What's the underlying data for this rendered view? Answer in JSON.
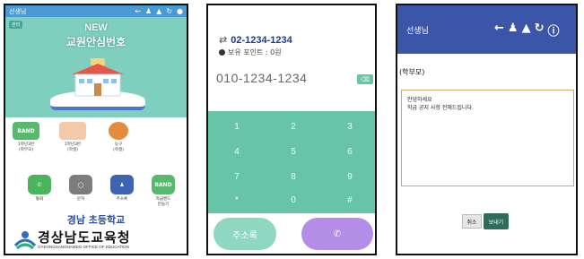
{
  "screen1": {
    "status_title": "선생님",
    "status_icons": [
      "back-arrow-icon",
      "person-icon",
      "bell-icon",
      "refresh-icon",
      "info-icon"
    ],
    "badge": "관리",
    "hero_new": "NEW",
    "hero_title": "교원안심번호",
    "shortcuts": [
      {
        "name": "band",
        "icon_text": "BAND",
        "label": "1학년3반\n(학부모)",
        "color": "#58b86c"
      },
      {
        "name": "class-photo",
        "icon_text": "",
        "label": "1학년3반\n(학생)",
        "color": "#f4c9a8"
      },
      {
        "name": "basketball",
        "icon_text": "",
        "label": "농구\n(학생)",
        "color": "#e58b3d"
      }
    ],
    "apps": [
      {
        "name": "call",
        "label": "통화",
        "color": "#4cb45c"
      },
      {
        "name": "sms",
        "label": "문자",
        "color": "#7d7d7d"
      },
      {
        "name": "contacts",
        "label": "주소록",
        "color": "#3f63b3"
      },
      {
        "name": "band-app",
        "icon_text": "BAND",
        "label": "학급밴드\n만들기",
        "color": "#58b86c"
      }
    ],
    "school_name": "경남 초등학교",
    "edu_office": "경상남도교육청",
    "edu_office_en": "GYEONGSANGNAMDO OFFICE OF EDUCATION"
  },
  "screen2": {
    "caller_number": "02-1234-1234",
    "points": "보유 포인트 : 0원",
    "dial_number": "010-1234-1234",
    "keys": [
      "1",
      "2",
      "3",
      "4",
      "5",
      "6",
      "7",
      "8",
      "9",
      "*",
      "0",
      "#"
    ],
    "addressbook_label": "주소록",
    "call_icon": "phone-icon"
  },
  "screen3": {
    "header_title": "선생님",
    "recipient_label": "(학부모)",
    "message_line1": "안녕하세요",
    "message_line2": "학급 공지 사항 전해드립니다.",
    "cancel_label": "취소",
    "send_label": "보내기"
  },
  "colors": {
    "teal": "#67c4a6",
    "blue_header": "#3b55a8",
    "purple": "#b48de6"
  }
}
